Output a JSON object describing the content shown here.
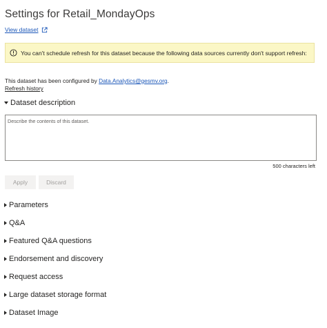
{
  "page": {
    "title": "Settings for Retail_MondayOps",
    "view_dataset_label": "View dataset"
  },
  "warning": {
    "text": "You can't schedule refresh for this dataset because the following data sources currently don't support refresh:"
  },
  "config": {
    "prefix": "This dataset has been configured by ",
    "owner": "Data.Analytics@gesmv.org",
    "suffix": ".",
    "refresh_history_label": "Refresh history"
  },
  "description": {
    "heading": "Dataset description",
    "placeholder": "Describe the contents of this dataset.",
    "chars_left": "500 characters left",
    "apply_label": "Apply",
    "discard_label": "Discard"
  },
  "sections": [
    "Parameters",
    "Q&A",
    "Featured Q&A questions",
    "Endorsement and discovery",
    "Request access",
    "Large dataset storage format",
    "Dataset Image"
  ],
  "icons": {
    "view_dataset": "external-link-icon",
    "warning": "info-circle-icon",
    "expanded": "caret-down-icon",
    "collapsed": "caret-right-icon"
  },
  "colors": {
    "link": "#1a56b8",
    "warning_bg": "#fbf7c6",
    "button_bg": "#f3f2f1",
    "button_text": "#a19f9d"
  }
}
